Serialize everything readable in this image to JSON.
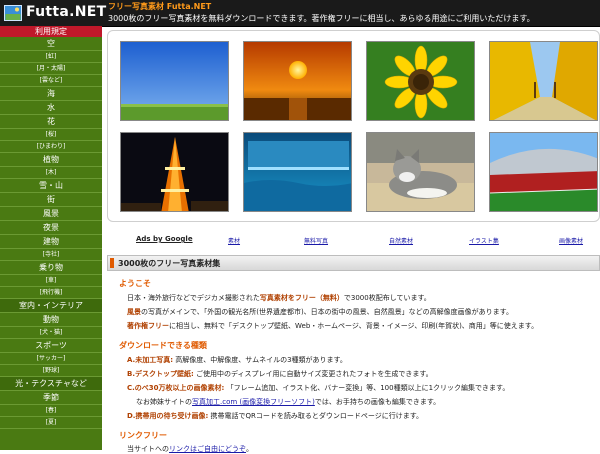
{
  "header": {
    "logo_text": "Futta.NET",
    "site_title": "フリー写真素材 Futta.NET",
    "description": "3000枚のフリー写真素材を無料ダウンロードできます。著作権フリーに相当し、あらゆる用途にご利用いただけます。"
  },
  "sidebar": {
    "heading": "利用規定",
    "items": [
      {
        "label": "空",
        "type": "main"
      },
      {
        "label": "[虹]",
        "type": "sub"
      },
      {
        "label": "[月・太陽]",
        "type": "sub"
      },
      {
        "label": "[雲など]",
        "type": "sub"
      },
      {
        "label": "海",
        "type": "main"
      },
      {
        "label": "水",
        "type": "main"
      },
      {
        "label": "花",
        "type": "main"
      },
      {
        "label": "[桜]",
        "type": "sub"
      },
      {
        "label": "[ひまわり]",
        "type": "sub"
      },
      {
        "label": "植物",
        "type": "main"
      },
      {
        "label": "[木]",
        "type": "sub"
      },
      {
        "label": "雪・山",
        "type": "main"
      },
      {
        "label": "街",
        "type": "main"
      },
      {
        "label": "風景",
        "type": "main"
      },
      {
        "label": "夜景",
        "type": "main"
      },
      {
        "label": "建物",
        "type": "main"
      },
      {
        "label": "[寺社]",
        "type": "sub"
      },
      {
        "label": "乗り物",
        "type": "main"
      },
      {
        "label": "[車]",
        "type": "sub"
      },
      {
        "label": "[飛行機]",
        "type": "sub"
      },
      {
        "label": "室内・インテリア",
        "type": "cat"
      },
      {
        "label": "動物",
        "type": "main"
      },
      {
        "label": "[犬・猫]",
        "type": "sub"
      },
      {
        "label": "スポーツ",
        "type": "main"
      },
      {
        "label": "[サッカー]",
        "type": "sub"
      },
      {
        "label": "[野球]",
        "type": "sub"
      },
      {
        "label": "光・テクスチャなど",
        "type": "cat"
      },
      {
        "label": "季節",
        "type": "main"
      },
      {
        "label": "[春]",
        "type": "sub"
      },
      {
        "label": "[夏]",
        "type": "sub"
      }
    ]
  },
  "gallery": {
    "thumbnails": [
      "blue-sky-field",
      "sunset-sea",
      "sunflower",
      "ginkgo-avenue",
      "tokyo-tower-night",
      "blue-water-pool",
      "cat-on-table",
      "soccer-stadium"
    ]
  },
  "ads": {
    "label": "Ads by Google",
    "links": [
      "素材",
      "無料写真",
      "自然素材",
      "イラスト集",
      "画像素材"
    ]
  },
  "content": {
    "heading": "3000枚のフリー写真素材集",
    "welcome_title": "ようこそ",
    "welcome_lines": [
      {
        "a": "日本・海外旅行などでデジカメ撮影された",
        "b": "写真素材をフリー（無料）",
        "c": "で3000枚配布しています。"
      },
      {
        "a": "風景",
        "b": "の写真がメインで、「外国の観光名所(世界遺産都市)、日本の街中の風景、自然風景」などの高解像度画像があります。",
        "c": ""
      },
      {
        "a": "著作権フリー",
        "b": "に相当し、無料で「デスクトップ壁紙、Web・ホームページ、背景・イメージ、印刷(年賀状)、商用」等に使えます。",
        "c": ""
      }
    ],
    "download_title": "ダウンロードできる種類",
    "download_lines": [
      {
        "a": "A.未加工写真:",
        "b": " 高解像度、中解像度、サムネイルの3種類があります。"
      },
      {
        "a": "B.デスクトップ壁紙:",
        "b": " ご使用中のディスプレイ用に自動サイズ変更されたフォトを生成できます。"
      },
      {
        "a": "C.のべ30万枚以上の画像素材:",
        "b": " 「フレーム追加、イラスト化、バナー変換」等、100種類以上に1クリック編集できます。"
      },
      {
        "a": "なお姉妹サイトの",
        "link": "写真加工.com (画像変換フリーソフト)",
        "b": "では、お手持ちの画像も編集できます。"
      },
      {
        "a": "D.携帯用の待ち受け画像:",
        "b": " 携帯電話でQRコードを読み取るとダウンロードページに行けます。"
      }
    ],
    "link_title": "リンクフリー",
    "link_line": {
      "a": "当サイトへの",
      "link": "リンクはご自由にどうぞ",
      "b": "。"
    }
  }
}
